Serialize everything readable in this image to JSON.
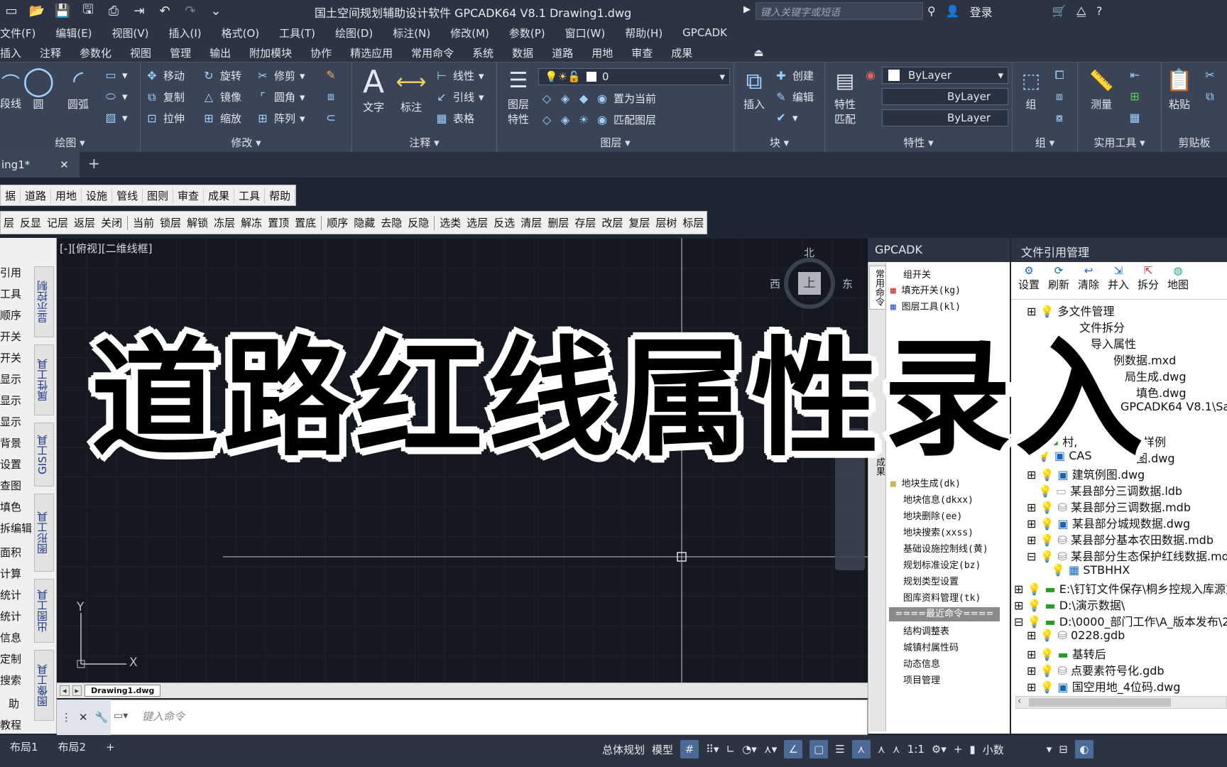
{
  "titlebar": {
    "title": "国土空间规划辅助设计软件 GPCADK64 V8.1    Drawing1.dwg",
    "search_placeholder": "键入关键字或短语",
    "login": "登录"
  },
  "menus": [
    "文件(F)",
    "编辑(E)",
    "视图(V)",
    "插入(I)",
    "格式(O)",
    "工具(T)",
    "绘图(D)",
    "标注(N)",
    "修改(M)",
    "参数(P)",
    "窗口(W)",
    "帮助(H)",
    "GPCADK"
  ],
  "ribbon_tabs": [
    "插入",
    "注释",
    "参数化",
    "视图",
    "管理",
    "输出",
    "附加模块",
    "协作",
    "精选应用",
    "常用命令",
    "系统",
    "数据",
    "道路",
    "用地",
    "审查",
    "成果"
  ],
  "ribbon": {
    "draw": {
      "title": "绘图",
      "line": "段线",
      "circle": "圆",
      "arc": "圆弧"
    },
    "modify": {
      "title": "修改",
      "move": "移动",
      "rotate": "旋转",
      "trim": "修剪",
      "copy": "复制",
      "mirror": "镜像",
      "fillet": "圆角",
      "stretch": "拉伸",
      "scale": "缩放",
      "array": "阵列"
    },
    "annotation": {
      "title": "注释",
      "text": "文字",
      "dim": "标注",
      "linear": "线性",
      "leader": "引线",
      "table": "表格"
    },
    "layers": {
      "title": "图层",
      "props": "图层\n特性",
      "layer_value": "0",
      "make_current": "置为当前",
      "match": "匹配图层"
    },
    "block": {
      "title": "块",
      "insert": "插入",
      "create": "创建",
      "edit": "编辑"
    },
    "properties": {
      "title": "特性",
      "match": "特性\n匹配",
      "color": "ByLayer",
      "linetype": "ByLayer",
      "lineweight": "ByLayer"
    },
    "group": {
      "title": "组",
      "group": "组"
    },
    "utilities": {
      "title": "实用工具",
      "measure": "测量"
    },
    "clipboard": {
      "title": "剪贴板",
      "paste": "粘贴"
    }
  },
  "doc_tab": "ing1*",
  "toolbar1": [
    "据",
    "道路",
    "用地",
    "设施",
    "管线",
    "图则",
    "审查",
    "成果",
    "工具",
    "帮助"
  ],
  "toolbar2": [
    "反显",
    "记层",
    "返层",
    "关闭",
    "|",
    "当前",
    "锁层",
    "解锁",
    "冻层",
    "解冻",
    "置顶",
    "置底",
    "|",
    "顺序",
    "隐藏",
    "去隐",
    "反隐",
    "|",
    "选类",
    "选层",
    "反选",
    "清层",
    "删层",
    "存层",
    "改层",
    "复层",
    "层树",
    "标层"
  ],
  "toolbar2_first": "层",
  "left_items": [
    "引用",
    "工具",
    "顺序",
    "开关",
    "开关",
    "显示",
    "显示",
    "显示",
    "背景",
    "设置",
    "查图",
    "填色",
    "拆编辑",
    "面积",
    "计算",
    "统计",
    "统计",
    "信息",
    "定制",
    "搜索",
    "助",
    "教程"
  ],
  "left_vtabs": [
    "显示控制",
    "属性工具",
    "GIS工具",
    "图形工具",
    "出图工具",
    "图像工具"
  ],
  "viewport": {
    "label": "[-][俯视][二维线框]",
    "compass_n": "北",
    "compass_w": "西",
    "compass_e": "东",
    "compass_top": "上",
    "file_tab": "Drawing1.dwg",
    "ucs_y": "Y",
    "ucs_x": "X"
  },
  "cmd_placeholder": "键入命令",
  "gpcadk": {
    "title": "GPCADK",
    "side_tabs": [
      "常用命令",
      "成果"
    ],
    "items": [
      "组开关",
      "填充开关(kg)",
      "图层工具(kl)",
      "地块生成(dk)",
      "地块信息(dkxx)",
      "地块删除(ee)",
      "地块搜索(xxss)",
      "基础设施控制线(黄)",
      "规划标准设定(bz)",
      "规划类型设置",
      "图库资料管理(tk)",
      "结构调整表",
      "城镇村属性码",
      "动态信息",
      "项目管理"
    ],
    "recent": "====最近命令===="
  },
  "fileref": {
    "title": "文件引用管理",
    "tools": [
      "设置",
      "刷新",
      "清除",
      "并入",
      "拆分",
      "地图"
    ],
    "tree": [
      "多文件管理",
      "文件拆分",
      "导入属性",
      "例数据.mxd",
      "局生成.dwg",
      "填色.dwg",
      "GPCADK64 V8.1\\Sar",
      "村,",
      "样例",
      "CAS",
      "图.dwg",
      "建筑例图.dwg",
      "某县部分三调数据.ldb",
      "某县部分三调数据.mdb",
      "某县部分城规数据.dwg",
      "某县部分基本农田数据.mdb",
      "某县部分生态保护红线数据.mdl",
      "STBHHX",
      "E:\\钉钉文件保存\\桐乡控规入库源文",
      "D:\\演示数据\\",
      "D:\\0000_部门工作\\A_版本发布\\20",
      "0228.gdb",
      "基转后",
      "点要素符号化.gdb",
      "国空用地_4位码.dwg"
    ]
  },
  "status": {
    "tabs": [
      "布局1",
      "布局2"
    ],
    "plan": "总体规划",
    "model": "模型",
    "scale": "1:1",
    "units": "小数"
  },
  "overlay_title": "道路红线属性录入"
}
